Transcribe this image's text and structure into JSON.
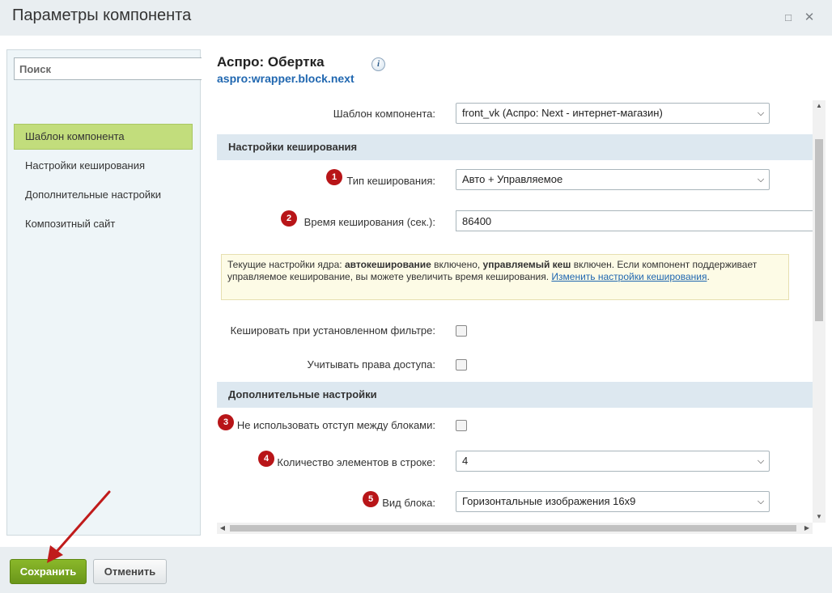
{
  "window": {
    "title": "Параметры компонента",
    "maximize_icon": "□",
    "close_icon": "✕"
  },
  "sidebar": {
    "search_placeholder": "Поиск",
    "items": [
      {
        "label": "Шаблон компонента",
        "active": true
      },
      {
        "label": "Настройки кеширования",
        "active": false
      },
      {
        "label": "Дополнительные настройки",
        "active": false
      },
      {
        "label": "Композитный сайт",
        "active": false
      }
    ]
  },
  "component": {
    "title": "Аспро: Обертка",
    "code": "aspro:wrapper.block.next",
    "info_icon": "i"
  },
  "form": {
    "template": {
      "label": "Шаблон компонента:",
      "value": "front_vk (Аспро: Next - интернет-магазин)"
    },
    "cache_section": "Настройки кеширования",
    "cache_type": {
      "badge": "1",
      "label": "Тип кеширования:",
      "value": "Авто + Управляемое"
    },
    "cache_time": {
      "badge": "2",
      "label": "Время кеширования (сек.):",
      "value": "86400"
    },
    "note": {
      "t1": "Текущие настройки ядра: ",
      "b1": "автокеширование",
      "t2": " включено, ",
      "b2": "управляемый кеш",
      "t3": " включен. Если компонент поддерживает управляемое кеширование, вы можете увеличить время кеширования. ",
      "link": "Изменить настройки кеширования",
      "t4": "."
    },
    "cache_filter": {
      "label": "Кешировать при установленном фильтре:",
      "checked": false
    },
    "access_rights": {
      "label": "Учитывать права доступа:",
      "checked": false
    },
    "extra_section": "Дополнительные настройки",
    "no_indent": {
      "badge": "3",
      "label": "Не использовать отступ между блоками:",
      "checked": false
    },
    "items_per_row": {
      "badge": "4",
      "label": "Количество элементов в строке:",
      "value": "4"
    },
    "block_view": {
      "badge": "5",
      "label": "Вид блока:",
      "value": "Горизонтальные изображения 16x9"
    }
  },
  "footer": {
    "save_label": "Сохранить",
    "cancel_label": "Отменить"
  },
  "colors": {
    "active_item": "#c2dd7c",
    "section_bg": "#dde8f0",
    "badge": "#b81518",
    "save_button": "#7aa823",
    "link": "#2067b0",
    "arrow": "#c01b1b"
  }
}
